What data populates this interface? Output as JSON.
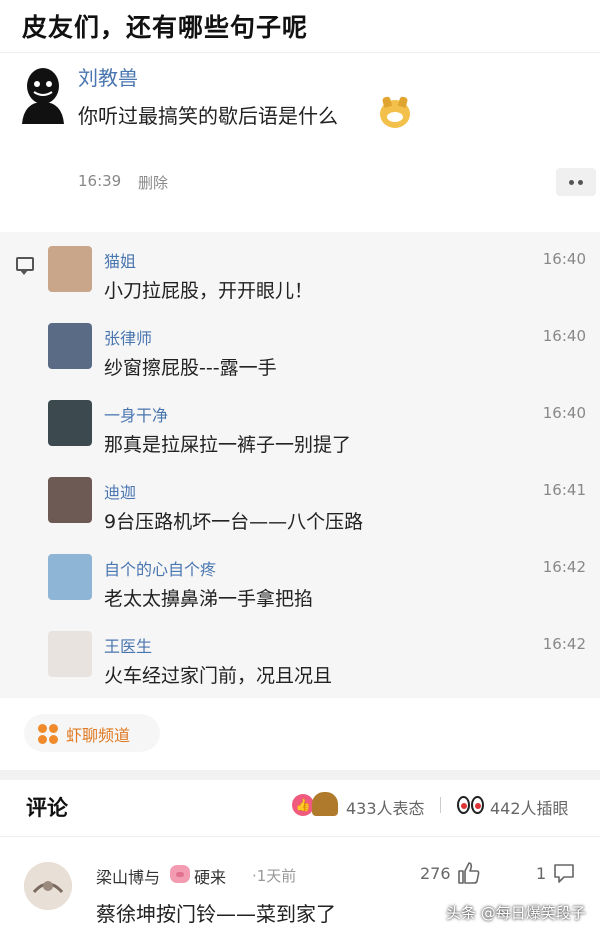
{
  "caption": "皮友们，还有哪些句子呢",
  "post": {
    "author": "刘教兽",
    "text": "你听过最搞笑的歇后语是什么",
    "time": "16:39",
    "delete_label": "删除"
  },
  "chat": [
    {
      "name": "猫姐",
      "text": "小刀拉屁股，开开眼儿！",
      "time": "16:40",
      "avatar_color": "#c9a58a"
    },
    {
      "name": "张律师",
      "text": "纱窗擦屁股---露一手",
      "time": "16:40",
      "avatar_color": "#5a6b86"
    },
    {
      "name": "一身干净",
      "text": "那真是拉屎拉一裤子一别提了",
      "time": "16:40",
      "avatar_color": "#3c4a4f"
    },
    {
      "name": "迪迦",
      "text": "9台压路机坏一台——八个压路",
      "time": "16:41",
      "avatar_color": "#6e5a55"
    },
    {
      "name": "自个的心自个疼",
      "text": "老太太擤鼻涕一手拿把掐",
      "time": "16:42",
      "avatar_color": "#8fb5d6"
    },
    {
      "name": "王医生",
      "text": "火车经过家门前，况且况且",
      "time": "16:42",
      "avatar_color": "#e9e3df"
    }
  ],
  "channel_tag": "虾聊频道",
  "comments_header": {
    "title": "评论",
    "reactions": "433人表态",
    "views": "442人插眼"
  },
  "comment": {
    "user_part1": "梁山博与",
    "user_part2": "硬来",
    "time": "·1天前",
    "likes": "276",
    "replies": "1",
    "text": "蔡徐坤按门铃——菜到家了"
  },
  "watermark": "头条 @每日爆笑段子",
  "colors": {
    "link_blue": "#4a76b0",
    "accent_orange": "#e07a22",
    "chat_bg": "#f6f6f6"
  }
}
